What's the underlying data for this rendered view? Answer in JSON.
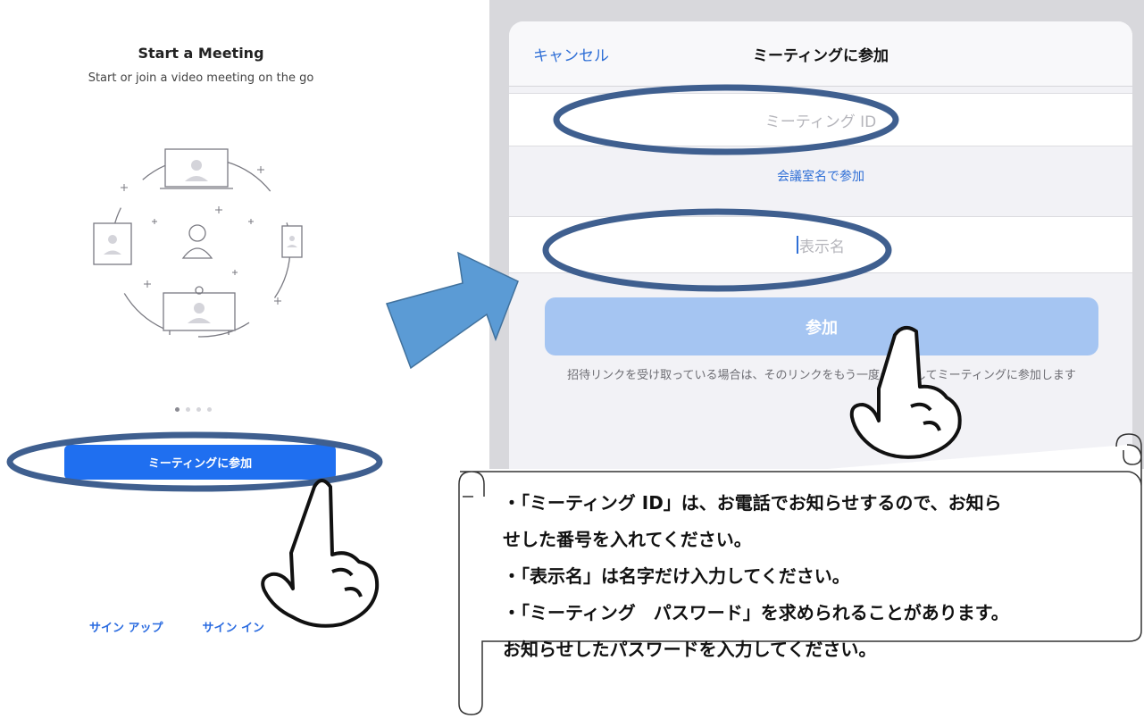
{
  "left": {
    "title": "Start a Meeting",
    "subtitle": "Start or join a video meeting on the go",
    "join_button": "ミーティングに参加",
    "page_dots": {
      "count": 4,
      "active_index": 0
    },
    "sign_up": "サイン アップ",
    "sign_in": "サイン イン"
  },
  "dialog": {
    "cancel": "キャンセル",
    "title": "ミーティングに参加",
    "meeting_id_placeholder": "ミーティング ID",
    "room_name_link": "会議室名で参加",
    "display_name_placeholder": "表示名",
    "join_button": "参加",
    "note": "招待リンクを受け取っている場合は、そのリンクをもう一度タップしてミーティングに参加します"
  },
  "instructions": {
    "line1": "・「ミーティング ID」は、お電話でお知らせするので、お知ら",
    "line2": "せした番号を入れてください。",
    "line3": "・「表示名」は名字だけ入力してください。",
    "line4": "・「ミーティング　パスワード」を求められることがあります。",
    "line5": "お知らせしたパスワードを入力してください。"
  },
  "colors": {
    "accent_blue": "#1f6ff0",
    "highlight_ellipse": "#3f5f8f",
    "arrow": "#5b9bd5",
    "dialog_join_bg": "#a5c5f2"
  },
  "icons": [
    "devices-illustration",
    "right-arrow",
    "pointing-hand-icon",
    "scroll-banner"
  ]
}
